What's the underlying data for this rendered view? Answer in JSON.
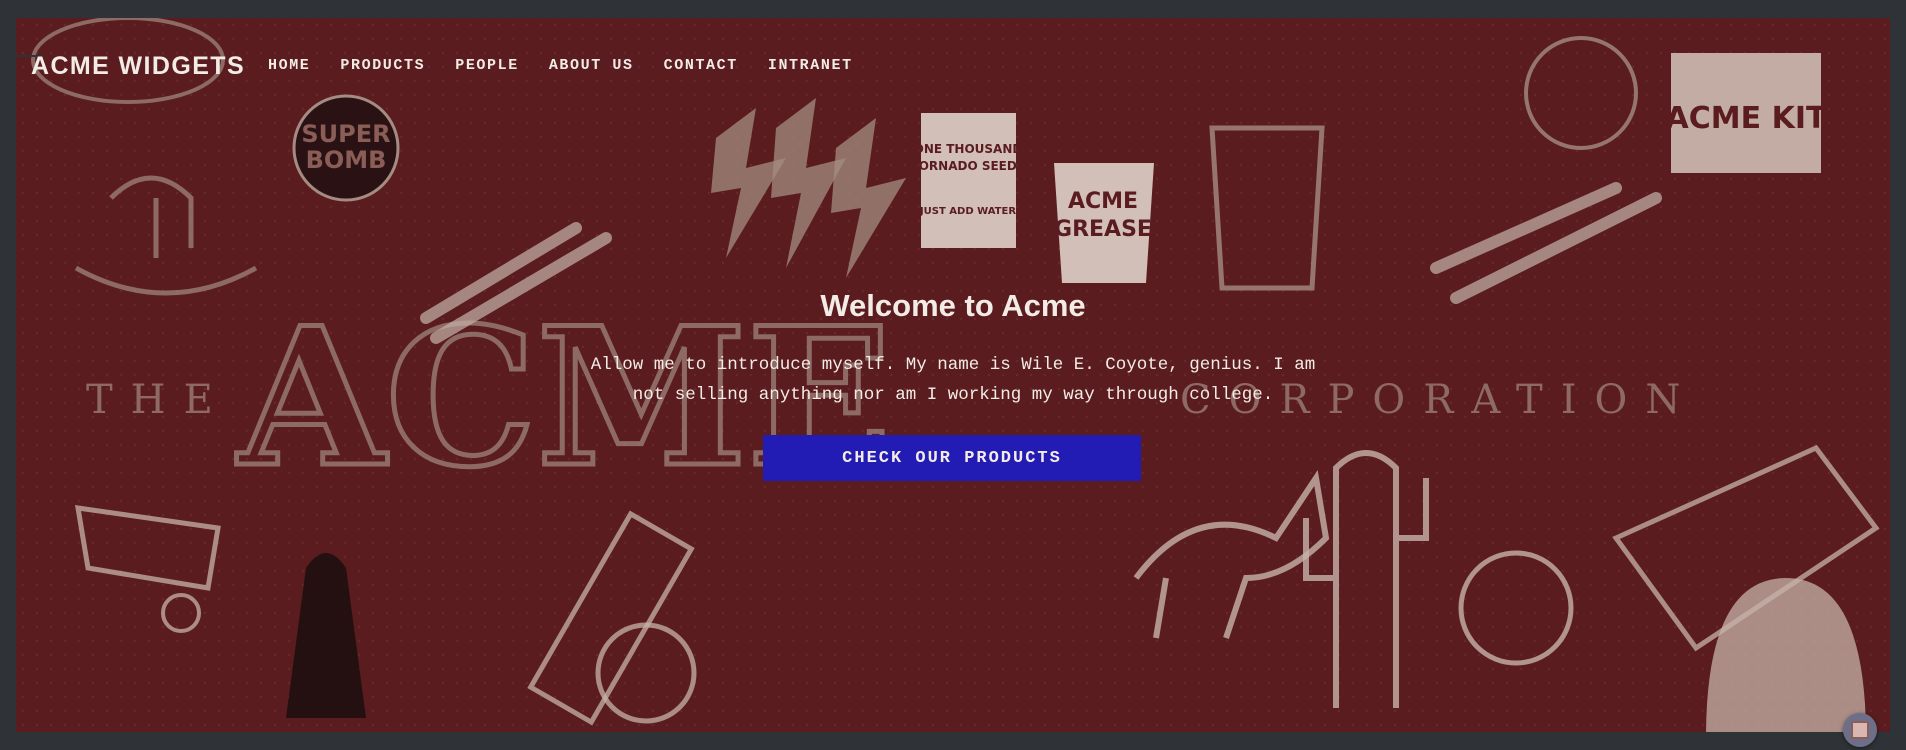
{
  "site": {
    "brand": "ACME WIDGETS"
  },
  "nav": {
    "items": [
      {
        "label": "HOME"
      },
      {
        "label": "PRODUCTS"
      },
      {
        "label": "PEOPLE"
      },
      {
        "label": "ABOUT US"
      },
      {
        "label": "CONTACT"
      },
      {
        "label": "INTRANET"
      }
    ]
  },
  "hero": {
    "title": "Welcome to Acme",
    "text": "Allow me to introduce myself. My name is Wile E. Coyote, genius. I am not selling anything nor am I working my way through college.",
    "cta_label": "CHECK OUR PRODUCTS",
    "background_text": {
      "left": "THE",
      "center": "ACME",
      "right": "CORPORATION"
    },
    "illustration_labels": [
      "SUPER BOMB",
      "ONE THOUSAND TORNADO SEEDS",
      "JUST ADD WATER",
      "ACME GREASE",
      "ACME KIT"
    ]
  },
  "colors": {
    "page": "#2f3337",
    "hero_bg": "#5a1c1f",
    "cta": "#231cb4",
    "text": "#f3ece6"
  },
  "icons": {
    "chat": "chat-widget-icon"
  }
}
